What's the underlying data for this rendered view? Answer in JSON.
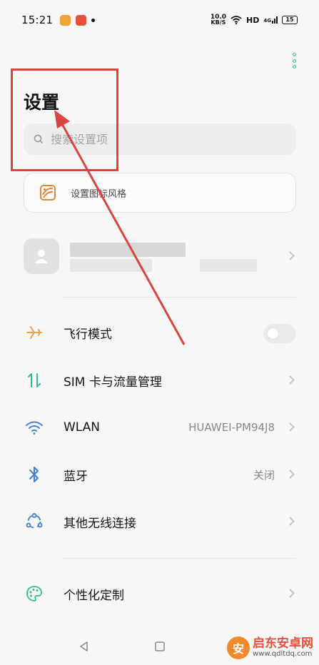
{
  "status_bar": {
    "time": "15:21",
    "net_speed_value": "10.0",
    "net_speed_unit": "KB/S",
    "hd": "HD",
    "cell_type": "4G",
    "battery": "15"
  },
  "header": {
    "title": "设置"
  },
  "search": {
    "placeholder": "搜索设置项"
  },
  "style_card": {
    "label": "设置图标风格"
  },
  "settings": [
    {
      "label": "飞行模式",
      "value": "",
      "control": "toggle"
    },
    {
      "label": "SIM 卡与流量管理",
      "value": "",
      "control": "chevron"
    },
    {
      "label": "WLAN",
      "value": "HUAWEI-PM94J8",
      "control": "chevron"
    },
    {
      "label": "蓝牙",
      "value": "关闭",
      "control": "chevron"
    },
    {
      "label": "其他无线连接",
      "value": "",
      "control": "chevron"
    },
    {
      "label": "个性化定制",
      "value": "",
      "control": "chevron"
    }
  ],
  "watermark": {
    "site_name": "启东安卓网",
    "site_url": "www.qdltdq.com"
  },
  "colors": {
    "accent_green": "#2fbf8c",
    "icon_orange": "#f0a03c",
    "icon_blue": "#3f7fd6",
    "annotation_red": "#d9453e"
  }
}
